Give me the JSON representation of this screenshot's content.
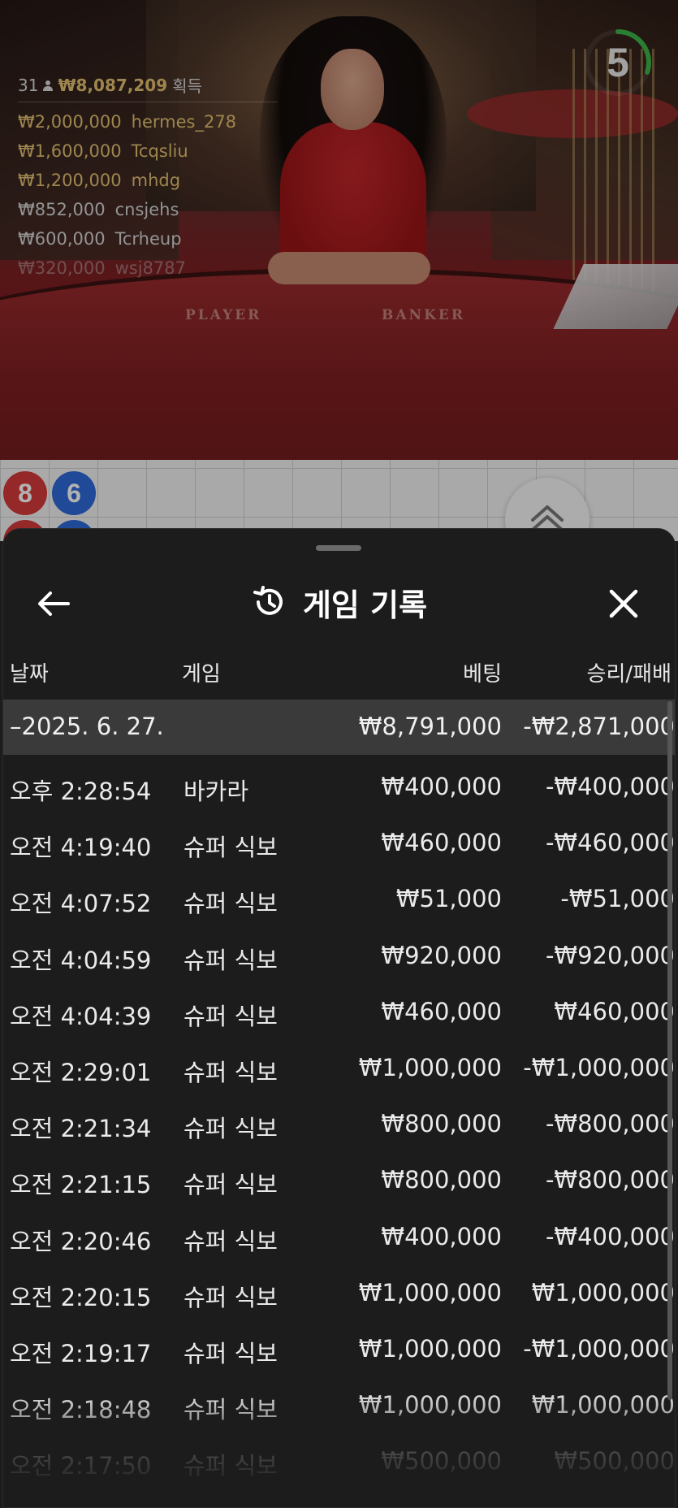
{
  "timer": {
    "value": "5",
    "progress": 0.3,
    "color": "#3bb54a"
  },
  "leaderboard": {
    "players_count": "31",
    "total": "₩8,087,209",
    "suffix": "획득",
    "entries": [
      {
        "amount": "₩2,000,000",
        "name": "hermes_278"
      },
      {
        "amount": "₩1,600,000",
        "name": "Tcqsliu"
      },
      {
        "amount": "₩1,200,000",
        "name": "mhdg"
      },
      {
        "amount": "₩852,000",
        "name": "cnsjehs"
      },
      {
        "amount": "₩600,000",
        "name": "Tcrheup"
      },
      {
        "amount": "₩320,000",
        "name": "wsj8787"
      }
    ]
  },
  "table": {
    "player_label": "PLAYER",
    "banker_label": "BANKER"
  },
  "roadboard": {
    "beads": [
      {
        "value": "8",
        "color": "red"
      },
      {
        "value": "6",
        "color": "blue"
      }
    ]
  },
  "sheet": {
    "title": "게임 기록",
    "columns": {
      "date": "날짜",
      "game": "게임",
      "bet": "베팅",
      "result": "승리/패배"
    },
    "date_group": {
      "label": "–2025. 6. 27.",
      "bet": "₩8,791,000",
      "result": "-₩2,871,000"
    },
    "rows": [
      {
        "time": "오후 2:28:54",
        "game": "바카라",
        "bet": "₩400,000",
        "result": "-₩400,000"
      },
      {
        "time": "오전 4:19:40",
        "game": "슈퍼 식보",
        "bet": "₩460,000",
        "result": "-₩460,000"
      },
      {
        "time": "오전 4:07:52",
        "game": "슈퍼 식보",
        "bet": "₩51,000",
        "result": "-₩51,000"
      },
      {
        "time": "오전 4:04:59",
        "game": "슈퍼 식보",
        "bet": "₩920,000",
        "result": "-₩920,000"
      },
      {
        "time": "오전 4:04:39",
        "game": "슈퍼 식보",
        "bet": "₩460,000",
        "result": "₩460,000"
      },
      {
        "time": "오전 2:29:01",
        "game": "슈퍼 식보",
        "bet": "₩1,000,000",
        "result": "-₩1,000,000"
      },
      {
        "time": "오전 2:21:34",
        "game": "슈퍼 식보",
        "bet": "₩800,000",
        "result": "-₩800,000"
      },
      {
        "time": "오전 2:21:15",
        "game": "슈퍼 식보",
        "bet": "₩800,000",
        "result": "-₩800,000"
      },
      {
        "time": "오전 2:20:46",
        "game": "슈퍼 식보",
        "bet": "₩400,000",
        "result": "-₩400,000"
      },
      {
        "time": "오전 2:20:15",
        "game": "슈퍼 식보",
        "bet": "₩1,000,000",
        "result": "₩1,000,000"
      },
      {
        "time": "오전 2:19:17",
        "game": "슈퍼 식보",
        "bet": "₩1,000,000",
        "result": "-₩1,000,000"
      },
      {
        "time": "오전 2:18:48",
        "game": "슈퍼 식보",
        "bet": "₩1,000,000",
        "result": "₩1,000,000"
      },
      {
        "time": "오전 2:17:50",
        "game": "슈퍼 식보",
        "bet": "₩500,000",
        "result": "₩500,000"
      }
    ]
  }
}
